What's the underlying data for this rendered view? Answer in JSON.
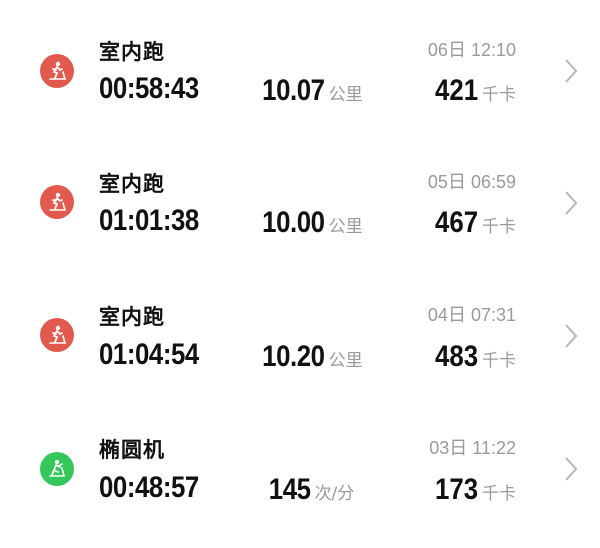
{
  "colors": {
    "run": "#e25a4d",
    "elliptical": "#34c759"
  },
  "activities": [
    {
      "type": "室内跑",
      "icon": "treadmill-icon",
      "color": "#e25a4d",
      "datetime": "06日 12:10",
      "duration": "00:58:43",
      "metric_value": "10.07",
      "metric_unit": "公里",
      "calories": "421",
      "calories_unit": "千卡"
    },
    {
      "type": "室内跑",
      "icon": "treadmill-icon",
      "color": "#e25a4d",
      "datetime": "05日 06:59",
      "duration": "01:01:38",
      "metric_value": "10.00",
      "metric_unit": "公里",
      "calories": "467",
      "calories_unit": "千卡"
    },
    {
      "type": "室内跑",
      "icon": "treadmill-icon",
      "color": "#e25a4d",
      "datetime": "04日 07:31",
      "duration": "01:04:54",
      "metric_value": "10.20",
      "metric_unit": "公里",
      "calories": "483",
      "calories_unit": "千卡"
    },
    {
      "type": "椭圆机",
      "icon": "elliptical-icon",
      "color": "#34c759",
      "datetime": "03日 11:22",
      "duration": "00:48:57",
      "metric_value": "145",
      "metric_unit": "次/分",
      "calories": "173",
      "calories_unit": "千卡"
    }
  ]
}
